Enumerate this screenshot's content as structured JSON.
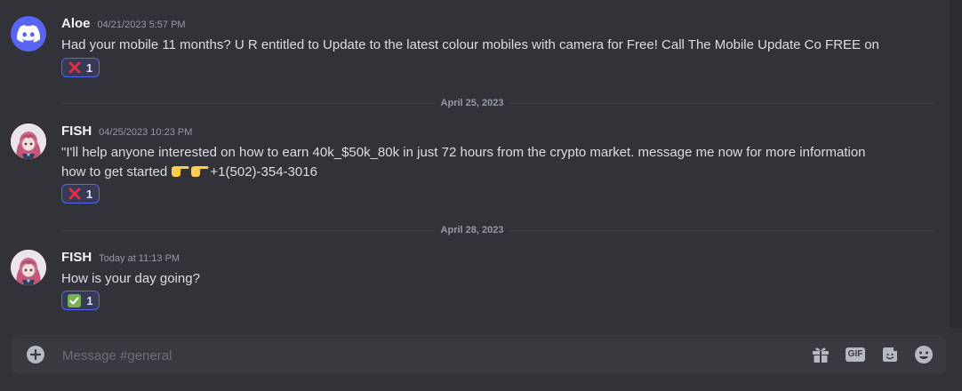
{
  "messages": [
    {
      "username": "Aloe",
      "timestamp": "04/21/2023 5:57 PM",
      "text": "Had your mobile 11 months? U R entitled to Update to the latest colour mobiles with camera for Free! Call The Mobile Update Co FREE on",
      "reaction": {
        "emoji": "cross-mark",
        "count": "1"
      },
      "avatar": "discord-logo"
    },
    {
      "username": "FISH",
      "timestamp": "04/25/2023 10:23 PM",
      "text_line1": "\"I'll help anyone interested on how to earn 40k_$50k_80k in just 72 hours from the crypto market. message me now for more information",
      "text_line2_prefix": "how to get started ",
      "text_line2_suffix": "+1(502)-354-3016",
      "reaction": {
        "emoji": "cross-mark",
        "count": "1"
      },
      "avatar": "anime-avatar"
    },
    {
      "username": "FISH",
      "timestamp": "Today at 11:13 PM",
      "text": "How is your day going?",
      "reaction": {
        "emoji": "check-mark-button",
        "count": "1"
      },
      "avatar": "anime-avatar"
    }
  ],
  "dividers": [
    "April 25, 2023",
    "April 28, 2023"
  ],
  "composer": {
    "placeholder": "Message #general",
    "gif_label": "GIF"
  },
  "colors": {
    "background": "#313338",
    "blurple": "#5865f2",
    "reaction_bg": "#373a54",
    "cross_red": "#dd2e44",
    "check_green": "#77b255"
  }
}
